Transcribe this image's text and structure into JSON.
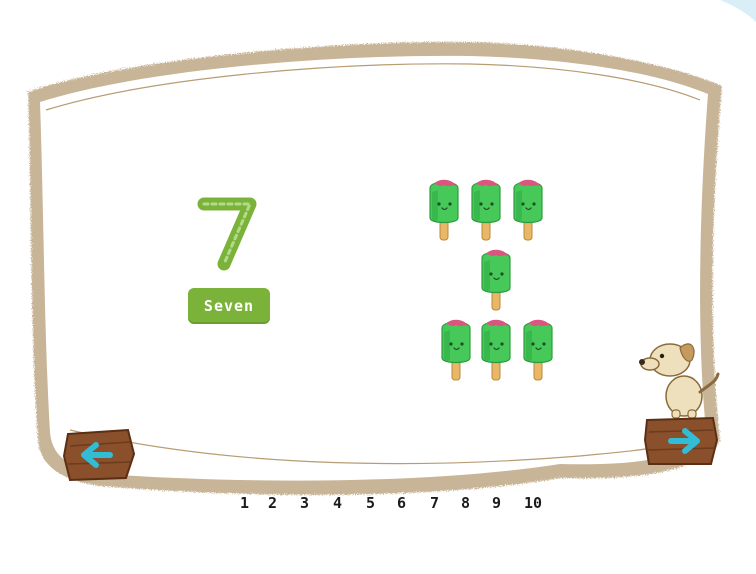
{
  "lesson": {
    "numeral": "7",
    "word": "Seven",
    "count": 7
  },
  "pager": {
    "numbers": [
      "1",
      "2",
      "3",
      "4",
      "5",
      "6",
      "7",
      "8",
      "9",
      "10"
    ],
    "current": "7"
  },
  "colors": {
    "accent_green": "#7bb33a",
    "popsicle_green": "#47c95a",
    "popsicle_pink": "#d9577f",
    "nav_arrow": "#33bcd6",
    "wood": "#8a4f2b"
  },
  "icons": {
    "prev": "arrow-left-icon",
    "next": "arrow-right-icon",
    "mascot": "dog-icon",
    "item": "popsicle-icon"
  }
}
